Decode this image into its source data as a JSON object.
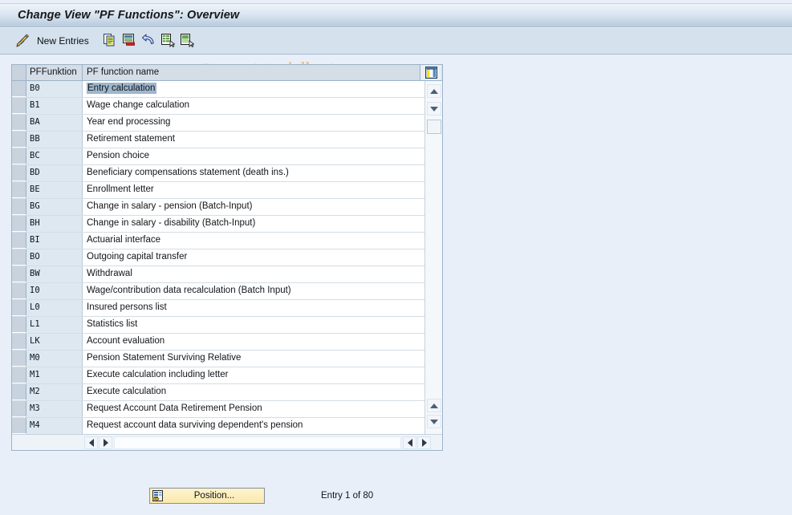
{
  "window": {
    "title": "Change View \"PF Functions\": Overview"
  },
  "toolbar": {
    "new_entries_label": "New Entries",
    "icons": [
      {
        "name": "pencil-display-change-icon",
        "title": "Display/Change"
      },
      {
        "name": "copy-icon",
        "title": "Copy As..."
      },
      {
        "name": "delete-icon",
        "title": "Delete"
      },
      {
        "name": "undo-icon",
        "title": "Undo Change"
      },
      {
        "name": "select-all-icon",
        "title": "Select All"
      },
      {
        "name": "deselect-all-icon",
        "title": "Deselect All"
      }
    ],
    "watermark": "www.tutorialkart.com",
    "watermark_mark": "©"
  },
  "table": {
    "columns": [
      {
        "key": "pffunktion",
        "label": "PFFunktion"
      },
      {
        "key": "name",
        "label": "PF function name"
      }
    ],
    "config_icon": "table-settings-icon",
    "selected_row_index": 0,
    "rows": [
      {
        "key": "B0",
        "name": "Entry calculation"
      },
      {
        "key": "B1",
        "name": "Wage change calculation"
      },
      {
        "key": "BA",
        "name": "Year end processing"
      },
      {
        "key": "BB",
        "name": "Retirement statement"
      },
      {
        "key": "BC",
        "name": "Pension choice"
      },
      {
        "key": "BD",
        "name": "Beneficiary compensations statement (death ins.)"
      },
      {
        "key": "BE",
        "name": "Enrollment letter"
      },
      {
        "key": "BG",
        "name": "Change in salary  - pension (Batch-Input)"
      },
      {
        "key": "BH",
        "name": "Change in salary  - disability (Batch-Input)"
      },
      {
        "key": "BI",
        "name": "Actuarial interface"
      },
      {
        "key": "BO",
        "name": "Outgoing capital transfer"
      },
      {
        "key": "BW",
        "name": "Withdrawal"
      },
      {
        "key": "I0",
        "name": "Wage/contribution data recalculation (Batch Input)"
      },
      {
        "key": "L0",
        "name": "Insured persons list"
      },
      {
        "key": "L1",
        "name": "Statistics list"
      },
      {
        "key": "LK",
        "name": "Account evaluation"
      },
      {
        "key": "M0",
        "name": "Pension Statement Surviving Relative"
      },
      {
        "key": "M1",
        "name": "Execute calculation including letter"
      },
      {
        "key": "M2",
        "name": "Execute calculation"
      },
      {
        "key": "M3",
        "name": "Request Account Data Retirement Pension"
      },
      {
        "key": "M4",
        "name": "Request account data surviving dependent's pension"
      }
    ]
  },
  "scrollbars": {
    "vertical_up_icon": "scroll-up-icon",
    "vertical_down_icon": "scroll-down-icon",
    "horizontal_left_icon": "scroll-left-icon",
    "horizontal_right_icon": "scroll-right-icon"
  },
  "footer": {
    "position_button_label": "Position...",
    "position_button_icon": "position-icon",
    "entry_status": "Entry 1 of 80"
  },
  "colors": {
    "page_background": "#e8eff8",
    "titlebar_top": "#eef4fa",
    "titlebar_bottom": "#b9cbdd",
    "toolbar_background": "#d5e1ec",
    "grid_border": "#9bb3c9",
    "header_background": "#d5dde6",
    "key_cell_background": "#dde8f1",
    "selection_highlight": "#9fb6cd",
    "button_yellow_top": "#fdf3cd",
    "button_yellow_bottom": "#fae9ae",
    "watermark_color": "#eec08a"
  }
}
